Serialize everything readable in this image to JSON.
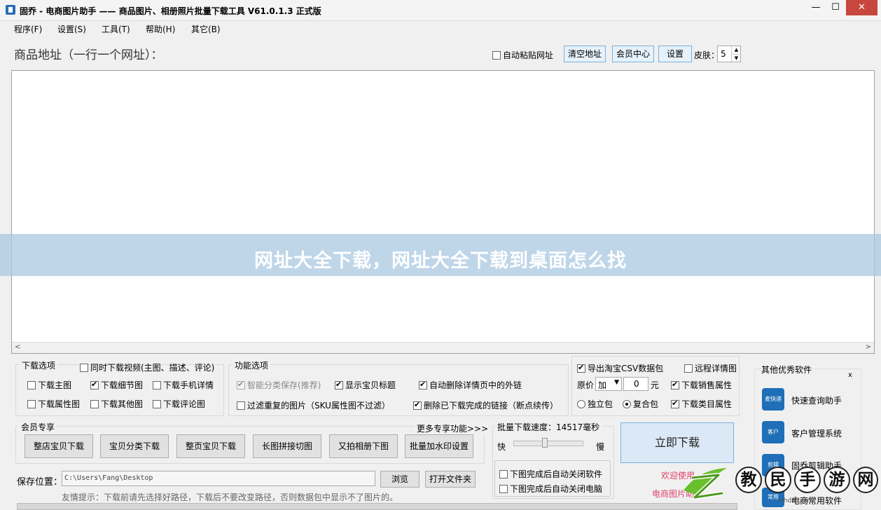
{
  "window": {
    "title": "固乔 - 电商图片助手 —— 商品图片、相册照片批量下载工具 V61.0.1.3 正式版",
    "minimize": "—",
    "maximize": "☐",
    "close": "✕"
  },
  "menu": [
    "程序(F)",
    "设置(S)",
    "工具(T)",
    "帮助(H)",
    "其它(B)"
  ],
  "top": {
    "url_label": "商品地址（一行一个网址）：",
    "auto_paste": "自动粘贴网址",
    "auto_paste_checked": false,
    "clear_button": "清空地址",
    "member_button": "会员中心",
    "settings_button": "设置",
    "skin_label": "皮肤：",
    "skin_value": "5"
  },
  "overlay": {
    "text": "网址大全下载，网址大全下载到桌面怎么找"
  },
  "download_options": {
    "title": "下载选项",
    "video": {
      "label": "同时下载视频(主图、描述、评论)",
      "checked": false
    },
    "items": [
      {
        "label": "下载主图",
        "checked": false
      },
      {
        "label": "下载细节图",
        "checked": true
      },
      {
        "label": "下载手机详情",
        "checked": false
      },
      {
        "label": "下载属性图",
        "checked": false
      },
      {
        "label": "下载其他图",
        "checked": false
      },
      {
        "label": "下载评论图",
        "checked": false
      }
    ]
  },
  "function_options": {
    "title": "功能选项",
    "items": [
      {
        "label": "智能分类保存(推荐)",
        "checked": true,
        "disabled": true
      },
      {
        "label": "显示宝贝标题",
        "checked": true
      },
      {
        "label": "自动删除详情页中的外链",
        "checked": true
      },
      {
        "label": "过滤重复的图片（SKU属性图不过滤）",
        "checked": false
      },
      {
        "label": "删除已下载完成的链接（断点续传）",
        "checked": true
      }
    ]
  },
  "export_options": {
    "csv": {
      "label": "导出淘宝CSV数据包",
      "checked": true
    },
    "remote": {
      "label": "远程详情图",
      "checked": false
    },
    "price_label": "原价",
    "price_op": "加",
    "price_value": "0",
    "price_unit": "元",
    "sales_attr": {
      "label": "下载销售属性",
      "checked": true
    },
    "single_pkg": {
      "label": "独立包",
      "selected": false
    },
    "combo_pkg": {
      "label": "复合包",
      "selected": true
    },
    "category_attr": {
      "label": "下载类目属性",
      "checked": true
    }
  },
  "member": {
    "title": "会员专享",
    "more": "更多专享功能>>>",
    "buttons": [
      "整店宝贝下载",
      "宝贝分类下载",
      "整页宝贝下载",
      "长图拼接切图",
      "又拍相册下图",
      "批量加水印设置"
    ]
  },
  "speed": {
    "title": "批量下载速度：14517毫秒",
    "fast": "快",
    "slow": "慢",
    "value": 0.45,
    "close_app": {
      "label": "下图完成后自动关闭软件",
      "checked": false
    },
    "shutdown": {
      "label": "下图完成后自动关闭电脑",
      "checked": false
    }
  },
  "start": {
    "button": "立即下载",
    "welcome_line1": "欢迎使用",
    "welcome_line2": "电商图片助手"
  },
  "save": {
    "label": "保存位置：",
    "path": "C:\\Users\\Fang\\Desktop",
    "browse": "浏览",
    "open_folder": "打开文件夹",
    "tip": "友情提示：下载前请先选择好路径，下载后不要改变路径，否则数据包中显示不了图片的。"
  },
  "right_panel": {
    "title": "其他优秀软件",
    "close": "x",
    "items": [
      {
        "label": "快速查询助手",
        "icon": "麦快递"
      },
      {
        "label": "客户管理系统",
        "icon": "客户"
      },
      {
        "label": "固乔剪辑助手",
        "icon": "剪辑"
      },
      {
        "label": "电商常用软件",
        "icon": "常用"
      }
    ]
  },
  "watermark": {
    "chars": [
      "教",
      "民",
      "手",
      "游",
      "网"
    ],
    "url": "mhdn.com"
  }
}
